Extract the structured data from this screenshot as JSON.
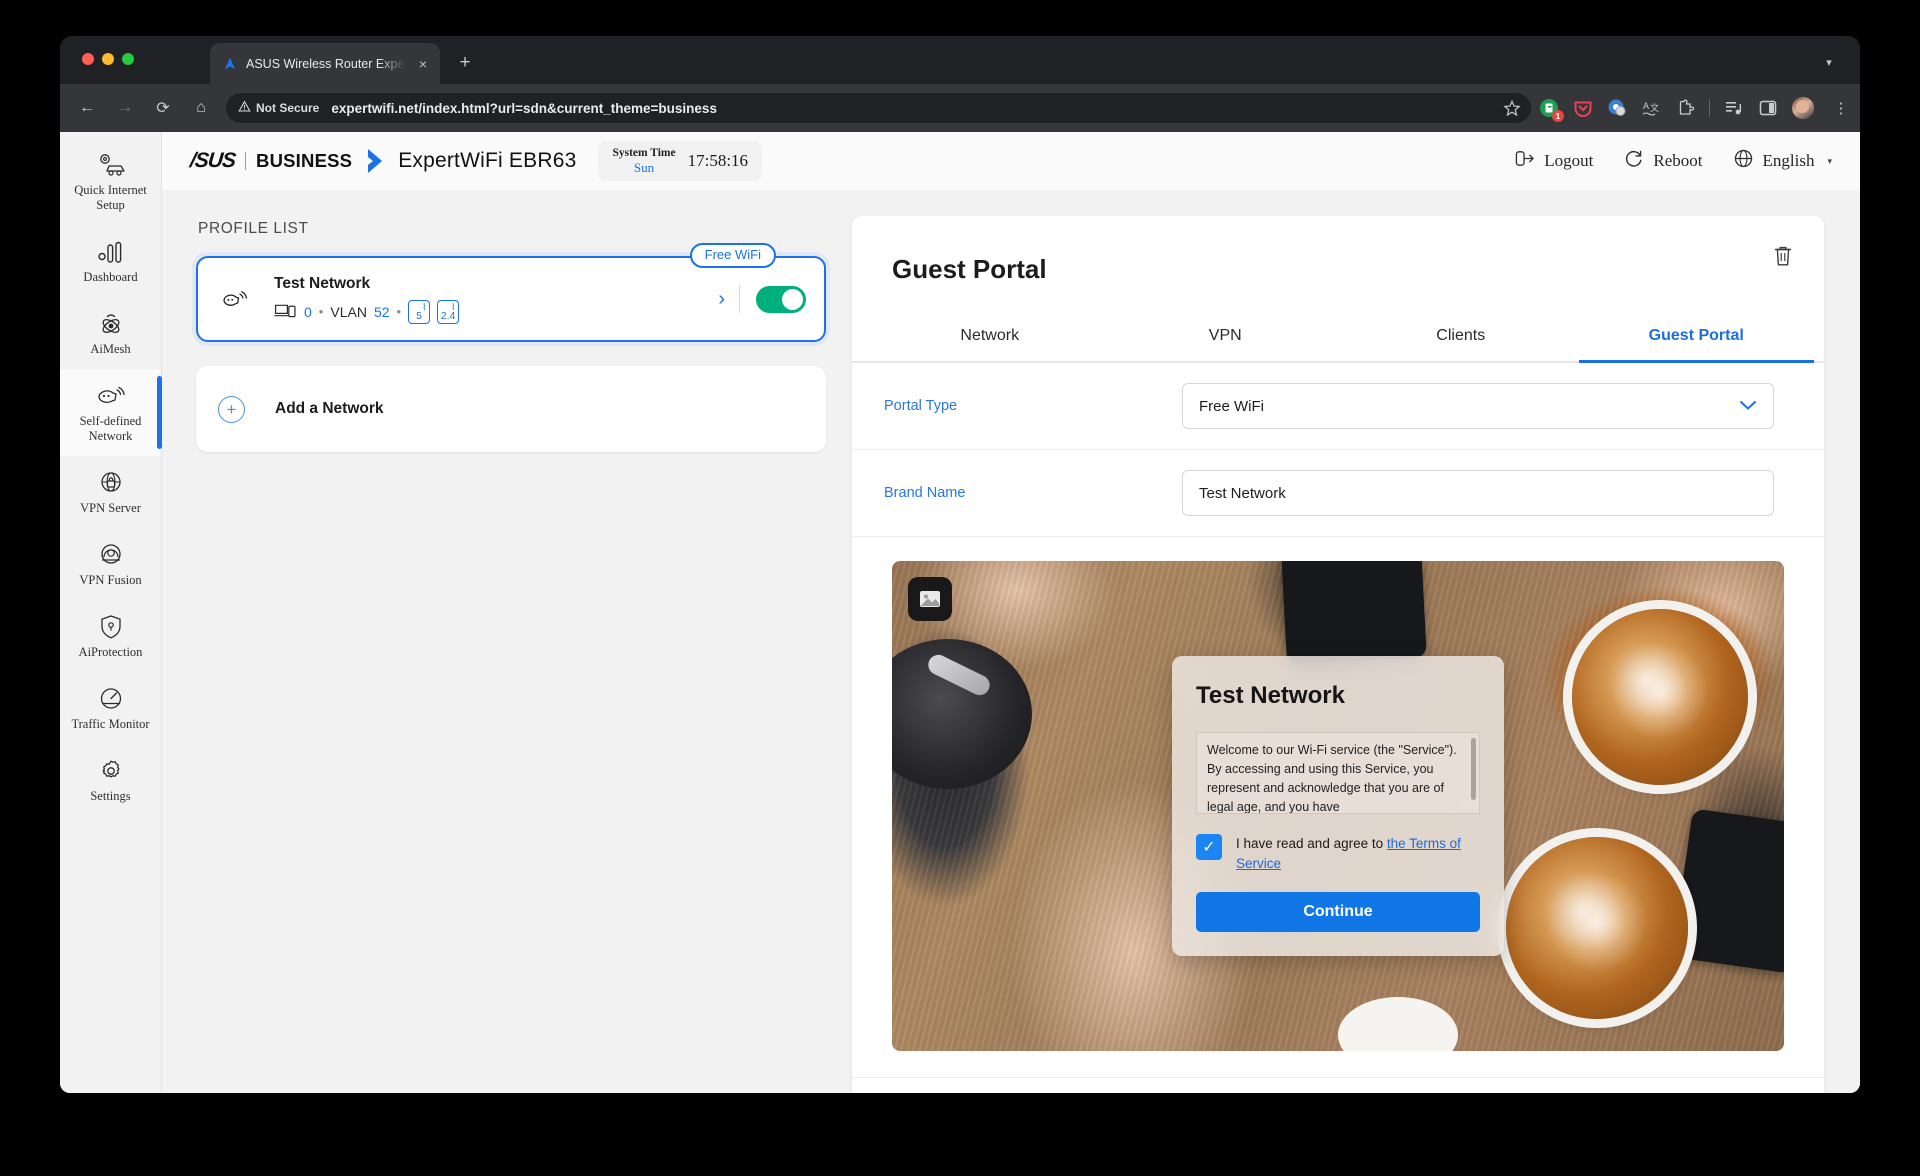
{
  "browser": {
    "tab": {
      "title": "ASUS Wireless Router Expert",
      "favicon": "asus-logo-icon",
      "close": "×"
    },
    "new_tab": "+",
    "tab_list_caret": "▾",
    "nav": {
      "back": "←",
      "forward": "→",
      "reload": "⟳",
      "home": "⌂"
    },
    "omnibox": {
      "security_label": "Not Secure",
      "security_icon": "warning-triangle-icon",
      "url": "expertwifi.net/index.html?url=sdn&current_theme=business",
      "bookmark_icon": "star-icon"
    },
    "extensions": [
      {
        "name": "password-manager-extension",
        "badge": "1"
      },
      {
        "name": "pocket-extension",
        "badge": ""
      },
      {
        "name": "privacy-extension",
        "badge": ""
      },
      {
        "name": "translate-extension",
        "badge": ""
      },
      {
        "name": "extensions-puzzle-icon",
        "badge": ""
      },
      {
        "name": "reading-list-icon",
        "badge": ""
      },
      {
        "name": "side-panel-icon",
        "badge": ""
      }
    ],
    "menu_icon": "⋮"
  },
  "sidebar": {
    "items": [
      {
        "label": "Quick Internet Setup",
        "icon": "quick-setup-icon",
        "active": false
      },
      {
        "label": "Dashboard",
        "icon": "dashboard-icon",
        "active": false
      },
      {
        "label": "AiMesh",
        "icon": "aimesh-icon",
        "active": false
      },
      {
        "label": "Self-defined Network",
        "icon": "self-defined-network-icon",
        "active": true
      },
      {
        "label": "VPN Server",
        "icon": "vpn-server-icon",
        "active": false
      },
      {
        "label": "VPN Fusion",
        "icon": "vpn-fusion-icon",
        "active": false
      },
      {
        "label": "AiProtection",
        "icon": "shield-icon",
        "active": false
      },
      {
        "label": "Traffic Monitor",
        "icon": "traffic-monitor-icon",
        "active": false
      },
      {
        "label": "Settings",
        "icon": "gear-icon",
        "active": false
      }
    ]
  },
  "header": {
    "logo": "/SUS",
    "business": "BUSINESS",
    "model": "ExpertWiFi EBR63",
    "system_time_label": "System Time",
    "system_time_day": "Sun",
    "system_time_clock": "17:58:16",
    "logout": "Logout",
    "reboot": "Reboot",
    "language": "English",
    "language_caret": "▾"
  },
  "left": {
    "profile_list_title": "PROFILE LIST",
    "profile": {
      "chip": "Free WiFi",
      "name": "Test Network",
      "client_count": "0",
      "vlan_label": "VLAN",
      "vlan_id": "52",
      "separator": "•",
      "bands": [
        "5",
        "2.4"
      ],
      "arrow": "›",
      "enabled": true
    },
    "add_network": {
      "plus": "+",
      "label": "Add a Network"
    }
  },
  "panel": {
    "title": "Guest Portal",
    "delete_icon": "trash-icon",
    "tabs": [
      {
        "label": "Network",
        "active": false
      },
      {
        "label": "VPN",
        "active": false
      },
      {
        "label": "Clients",
        "active": false
      },
      {
        "label": "Guest Portal",
        "active": true
      }
    ],
    "fields": [
      {
        "label": "Portal Type",
        "value": "Free WiFi",
        "type": "select",
        "caret": "⌄"
      },
      {
        "label": "Brand Name",
        "value": "Test Network",
        "type": "text"
      }
    ],
    "preview": {
      "image_picker_icon": "image-picker-icon",
      "brand": "Test Network",
      "terms_text": "Welcome to our Wi-Fi service (the \"Service\"). By accessing and using this Service, you represent and acknowledge that you are of legal age, and you have",
      "consent_prefix": "I have read and agree to ",
      "consent_link": "the Terms of Service",
      "consent_checked": true,
      "check_glyph": "✓",
      "continue_label": "Continue"
    }
  },
  "colors": {
    "accent_blue": "#1a73e8",
    "toggle_green": "#00b07c",
    "portal_button_blue": "#1277e6",
    "badge_red": "#e8453c"
  }
}
